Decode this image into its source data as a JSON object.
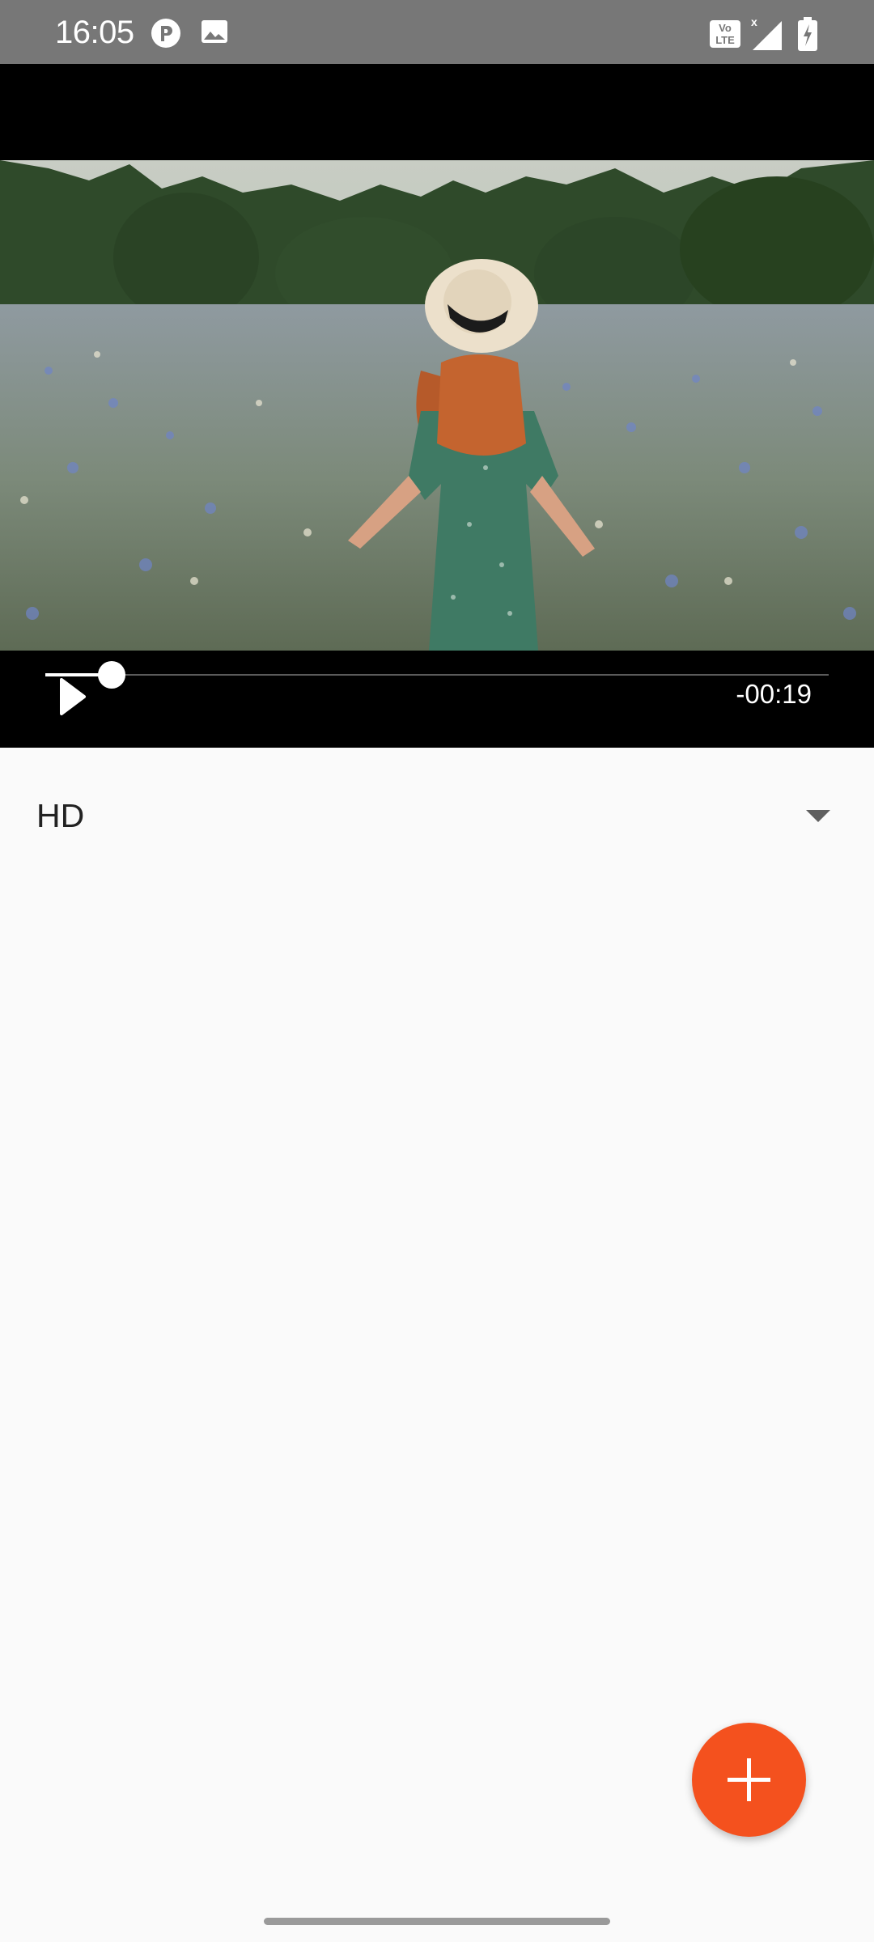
{
  "status_bar": {
    "time": "16:05",
    "icons_left": [
      "podcast-app-icon",
      "gallery-icon"
    ],
    "icons_right": [
      "volte-icon",
      "signal-icon",
      "battery-charging-icon"
    ],
    "background": "#777777"
  },
  "player": {
    "time_remaining": "-00:19",
    "progress_fraction": 0.085,
    "play_icon": "play-icon",
    "video_description_icon": "video-thumbnail"
  },
  "quality": {
    "selected": "HD"
  },
  "fab": {
    "icon": "plus-icon",
    "color": "#f4511e"
  }
}
